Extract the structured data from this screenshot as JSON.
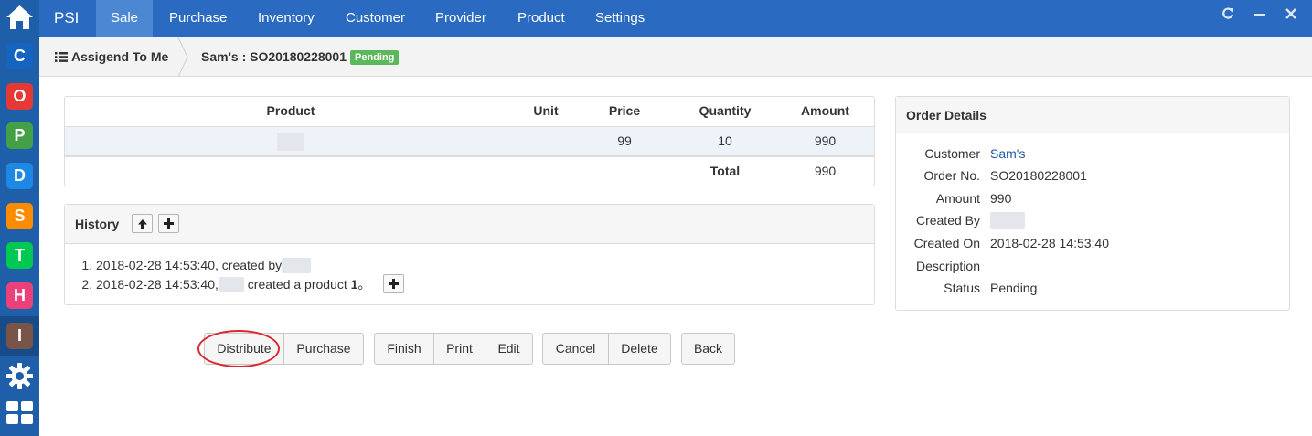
{
  "rail": {
    "apps": [
      {
        "icon": "home-icon"
      },
      {
        "letter": "C",
        "color": "#1565c0"
      },
      {
        "letter": "O",
        "color": "#e53935"
      },
      {
        "letter": "P",
        "color": "#43a047"
      },
      {
        "letter": "D",
        "color": "#1e88e5"
      },
      {
        "letter": "S",
        "color": "#fb8c00"
      },
      {
        "letter": "T",
        "color": "#00c853"
      },
      {
        "letter": "H",
        "color": "#ec407a"
      },
      {
        "letter": "I",
        "color": "#795548"
      }
    ]
  },
  "topnav": {
    "brand": "PSI",
    "tabs": [
      "Sale",
      "Purchase",
      "Inventory",
      "Customer",
      "Provider",
      "Product",
      "Settings"
    ],
    "active_tab": "Sale"
  },
  "breadcrumb": {
    "parent": "Assigend To Me",
    "current": "Sam's : SO20180228001",
    "status": "Pending"
  },
  "product_table": {
    "headers": {
      "product": "Product",
      "unit": "Unit",
      "price": "Price",
      "quantity": "Quantity",
      "amount": "Amount"
    },
    "rows": [
      {
        "product": "",
        "unit": "",
        "price": "99",
        "quantity": "10",
        "amount": "990"
      }
    ],
    "total_label": "Total",
    "total_amount": "990"
  },
  "history": {
    "title": "History",
    "entries": [
      {
        "time": "2018-02-28 14:53:40",
        "text": ", created by"
      },
      {
        "time": "2018-02-28 14:53:40",
        "text": "created a product",
        "count": "1",
        "suffix": "。"
      }
    ]
  },
  "order_details": {
    "title": "Order Details",
    "rows": [
      {
        "label": "Customer",
        "value": "Sam's"
      },
      {
        "label": "Order No.",
        "value": "SO20180228001"
      },
      {
        "label": "Amount",
        "value": "990"
      },
      {
        "label": "Created By",
        "value": ""
      },
      {
        "label": "Created On",
        "value": "2018-02-28 14:53:40"
      },
      {
        "label": "Description",
        "value": ""
      },
      {
        "label": "Status",
        "value": "Pending"
      }
    ]
  },
  "actions": {
    "distribute": "Distribute",
    "purchase": "Purchase",
    "finish": "Finish",
    "print": "Print",
    "edit": "Edit",
    "cancel": "Cancel",
    "delete": "Delete",
    "back": "Back"
  },
  "colors": {
    "nav": "#2a6bc1",
    "rail": "#1f5fa9",
    "badge": "#5cb85c",
    "highlight_circle": "#d9282f"
  }
}
